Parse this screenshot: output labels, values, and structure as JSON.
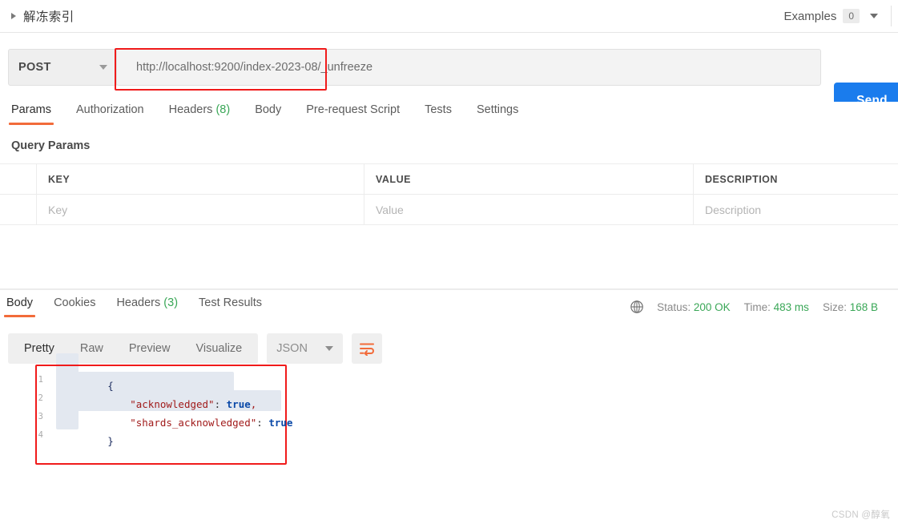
{
  "titlebar": {
    "request_name": "解冻索引",
    "expand_icon": "triangle-right-icon",
    "examples_label": "Examples",
    "examples_count": "0",
    "caret_icon": "chevron-down-icon"
  },
  "url_row": {
    "method": "POST",
    "method_caret": "chevron-down-icon",
    "url": "http://localhost:9200/index-2023-08/_unfreeze",
    "send_label": "Send",
    "send_color": "#1a7ced",
    "highlight_color": "#f01b1b"
  },
  "request_tabs": [
    {
      "label": "Params",
      "count": "",
      "active": true
    },
    {
      "label": "Authorization",
      "count": "",
      "active": false
    },
    {
      "label": "Headers",
      "count": "(8)",
      "active": false
    },
    {
      "label": "Body",
      "count": "",
      "active": false
    },
    {
      "label": "Pre-request Script",
      "count": "",
      "active": false
    },
    {
      "label": "Tests",
      "count": "",
      "active": false
    },
    {
      "label": "Settings",
      "count": "",
      "active": false
    }
  ],
  "query_params": {
    "section_label": "Query Params",
    "columns": [
      "KEY",
      "VALUE",
      "DESCRIPTION"
    ],
    "rows": [
      {
        "key": "Key",
        "value": "Value",
        "description": "Description"
      }
    ]
  },
  "response_tabs": [
    {
      "label": "Body",
      "count": "",
      "active": true
    },
    {
      "label": "Cookies",
      "count": "",
      "active": false
    },
    {
      "label": "Headers",
      "count": "(3)",
      "active": false
    },
    {
      "label": "Test Results",
      "count": "",
      "active": false
    }
  ],
  "response_meta": {
    "globe_icon": "globe-icon",
    "status_label": "Status:",
    "status_value": "200 OK",
    "time_label": "Time:",
    "time_value": "483 ms",
    "size_label": "Size:",
    "size_value": "168 B",
    "value_color": "#3aa757"
  },
  "viewer_toolbar": {
    "view_tabs": [
      {
        "label": "Pretty",
        "active": true
      },
      {
        "label": "Raw",
        "active": false
      },
      {
        "label": "Preview",
        "active": false
      },
      {
        "label": "Visualize",
        "active": false
      }
    ],
    "format": "JSON",
    "format_caret": "chevron-down-icon",
    "wrap_icon": "word-wrap-icon",
    "wrap_icon_color": "#f26b3a"
  },
  "response_body": {
    "language": "json",
    "lines": [
      {
        "no": "1",
        "text": "{"
      },
      {
        "no": "2",
        "text": "    \"acknowledged\": true,"
      },
      {
        "no": "3",
        "text": "    \"shards_acknowledged\": true"
      },
      {
        "no": "4",
        "text": "}"
      }
    ],
    "parsed": {
      "acknowledged": true,
      "shards_acknowledged": true
    },
    "tokens": {
      "open_brace": "{",
      "close_brace": "}",
      "key1": "\"acknowledged\"",
      "key2": "\"shards_acknowledged\"",
      "colon": ": ",
      "bool_true": "true",
      "comma": ","
    }
  },
  "watermark": "CSDN @醇氧"
}
